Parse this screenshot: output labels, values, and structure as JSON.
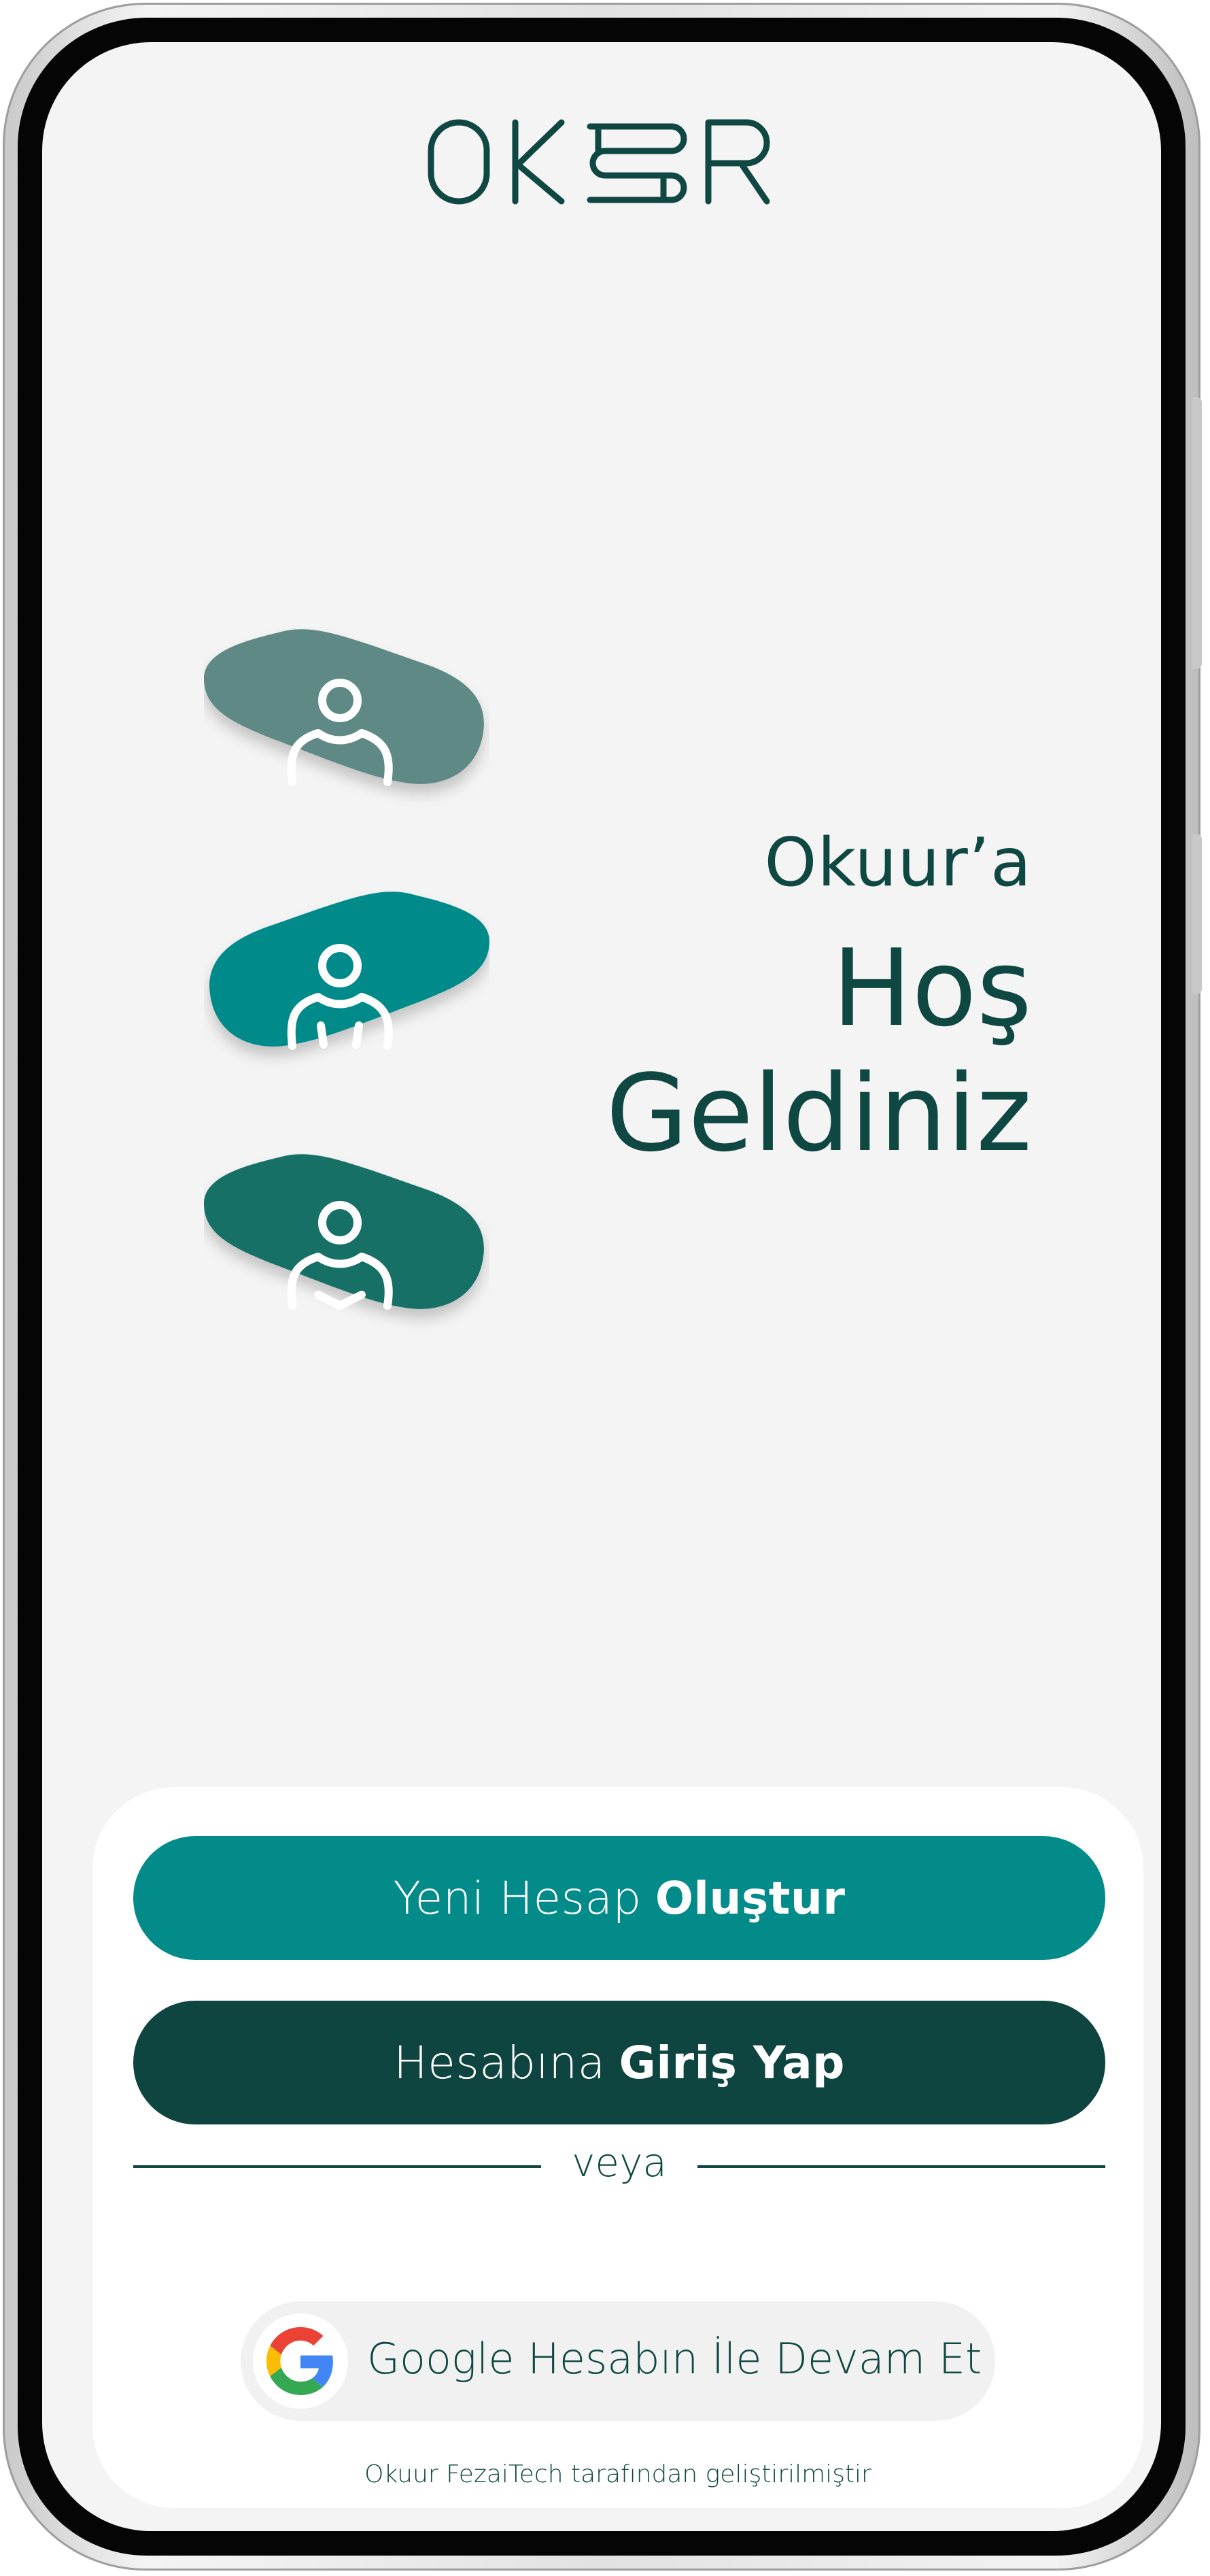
{
  "app": {
    "logo_text": "OKUUR"
  },
  "welcome": {
    "line1": "Okuur’a",
    "line2": "Hoş",
    "line3": "Geldiniz"
  },
  "avatars": [
    {
      "icon": "user-icon",
      "color": "#5f8985"
    },
    {
      "icon": "user-icon",
      "color": "#038b8a"
    },
    {
      "icon": "user-icon",
      "color": "#177066"
    }
  ],
  "actions": {
    "create_prefix": "Yeni Hesap",
    "create_bold": "Oluştur",
    "login_prefix": "Hesabına",
    "login_bold": "Giriş Yap",
    "divider_text": "veya",
    "google_label": "Google Hesabın İle Devam Et"
  },
  "footer": {
    "note": "Okuur FezaiTech tarafından geliştirilmiştir"
  },
  "colors": {
    "teal": "#038b8a",
    "dark_green": "#0f4540",
    "background": "#f4f4f4"
  }
}
